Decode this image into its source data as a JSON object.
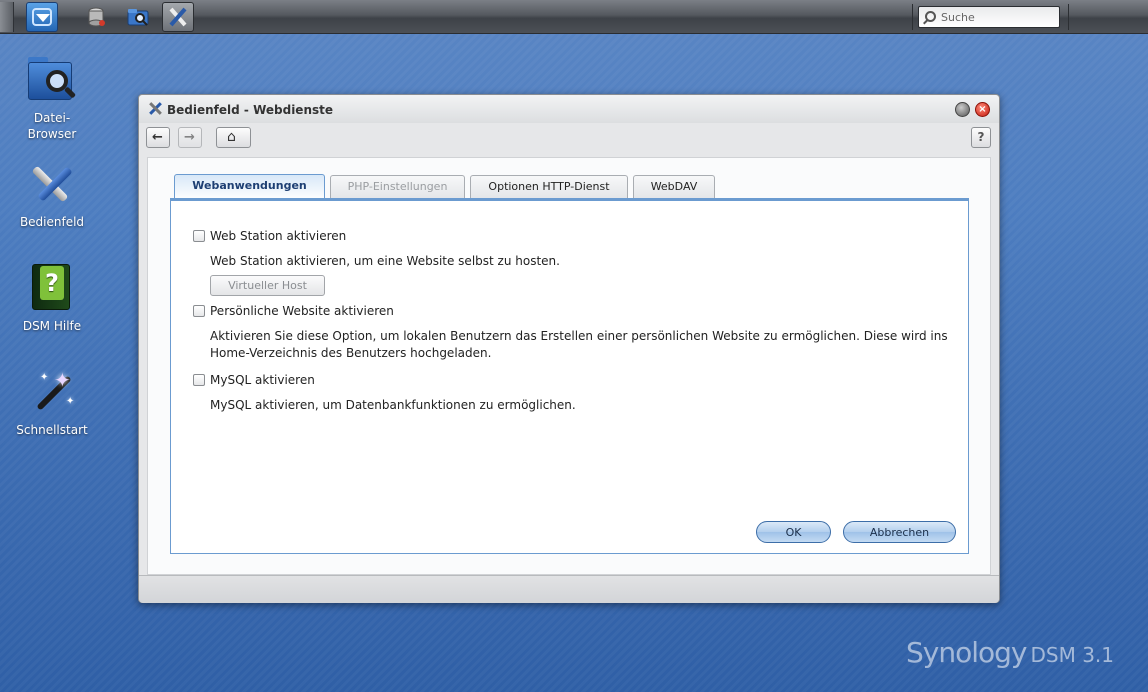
{
  "taskbar": {
    "search_placeholder": "Suche",
    "buttons": [
      "main-menu",
      "storage-manager",
      "file-browser",
      "control-panel"
    ]
  },
  "desktop": {
    "icons": [
      {
        "label_line1": "Datei-",
        "label_line2": "Browser",
        "icon": "folder-search-icon"
      },
      {
        "label": "Bedienfeld",
        "icon": "tools-icon"
      },
      {
        "label": "DSM Hilfe",
        "icon": "help-book-icon"
      },
      {
        "label": "Schnellstart",
        "icon": "magic-wand-icon"
      }
    ]
  },
  "window": {
    "title": "Bedienfeld - Webdienste",
    "help_label": "?",
    "close_glyph": "×",
    "tabs": [
      {
        "label": "Webanwendungen",
        "state": "active"
      },
      {
        "label": "PHP-Einstellungen",
        "state": "disabled"
      },
      {
        "label": "Optionen HTTP-Dienst",
        "state": "normal"
      },
      {
        "label": "WebDAV",
        "state": "normal"
      }
    ],
    "options": [
      {
        "label": "Web Station aktivieren",
        "checked": false,
        "description": "Web Station aktivieren, um eine Website selbst zu hosten.",
        "button": "Virtueller Host"
      },
      {
        "label": "Persönliche Website aktivieren",
        "checked": false,
        "description": "Aktivieren Sie diese Option, um lokalen Benutzern das Erstellen einer persönlichen Website zu ermöglichen. Diese wird ins Home-Verzeichnis des Benutzers hochgeladen."
      },
      {
        "label": "MySQL aktivieren",
        "checked": false,
        "description": "MySQL aktivieren, um Datenbankfunktionen zu ermöglichen."
      }
    ],
    "ok_label": "OK",
    "cancel_label": "Abbrechen"
  },
  "branding": {
    "name": "Synology",
    "suffix": "DSM 3.1"
  },
  "colors": {
    "desktop_bg": "#4d7dc0",
    "tab_active": "#1e3f73",
    "panel_border": "#6b9bd0",
    "close_button": "#c41a0c"
  }
}
